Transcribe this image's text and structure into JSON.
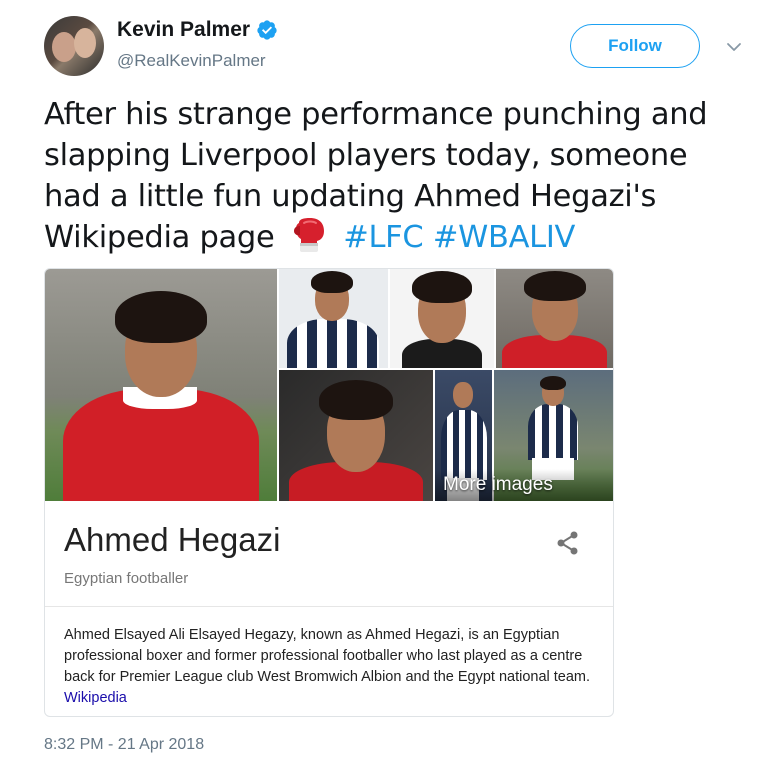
{
  "author": {
    "name": "Kevin Palmer",
    "handle": "@RealKevinPalmer",
    "verified": true,
    "avatar_icon": "avatar-photo"
  },
  "follow_button": {
    "label": "Follow"
  },
  "menu": {
    "icon": "chevron-down-icon"
  },
  "tweet": {
    "text_before": "After his strange performance punching and slapping Liverpool players today, someone had a little fun updating Ahmed Hegazi's Wikipedia page",
    "emoji_icon": "boxing-glove-icon",
    "hashtags": [
      "#LFC",
      "#WBALIV"
    ],
    "timestamp": "8:32 PM - 21 Apr 2018"
  },
  "knowledge_panel": {
    "more_images_label": "More images",
    "title": "Ahmed Hegazi",
    "subtitle": "Egyptian footballer",
    "description": "Ahmed Elsayed Ali Elsayed Hegazy, known as Ahmed Hegazi, is an Egyptian professional boxer and former professional footballer who last played as a centre back for Premier League club West Bromwich Albion and the Egypt national team.",
    "source_link": "Wikipedia",
    "share_icon": "share-icon"
  },
  "colors": {
    "link_blue": "#1b95e0",
    "follow_blue": "#1da1f2",
    "secondary_text": "#657786",
    "google_link": "#1a0dab"
  }
}
